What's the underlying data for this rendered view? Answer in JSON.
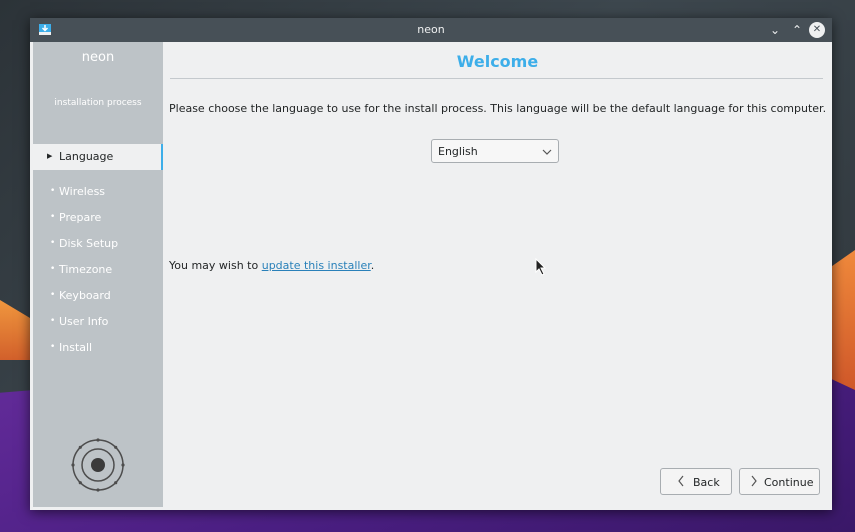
{
  "window": {
    "title": "neon",
    "controls": {
      "minimize": "⌄",
      "maximize": "⌃",
      "close": "✕"
    }
  },
  "sidebar": {
    "brand": "neon",
    "subtitle": "installation process",
    "items": [
      {
        "label": "Language",
        "active": true
      },
      {
        "label": "Wireless",
        "active": false
      },
      {
        "label": "Prepare",
        "active": false
      },
      {
        "label": "Disk Setup",
        "active": false
      },
      {
        "label": "Timezone",
        "active": false
      },
      {
        "label": "Keyboard",
        "active": false
      },
      {
        "label": "User Info",
        "active": false
      },
      {
        "label": "Install",
        "active": false
      }
    ],
    "active_marker": "▶",
    "inactive_marker": "•"
  },
  "main": {
    "heading": "Welcome",
    "prompt": "Please choose the language to use for the install process. This language will be the default language for this computer.",
    "language_select": {
      "value": "English"
    },
    "update_prefix": "You may wish to ",
    "update_link": "update this installer",
    "update_suffix": "."
  },
  "buttons": {
    "back": "Back",
    "continue": "Continue"
  },
  "colors": {
    "accent": "#3daee9",
    "link": "#2980b9",
    "titlebar": "#475057",
    "sidebar": "#bdc3c7"
  }
}
